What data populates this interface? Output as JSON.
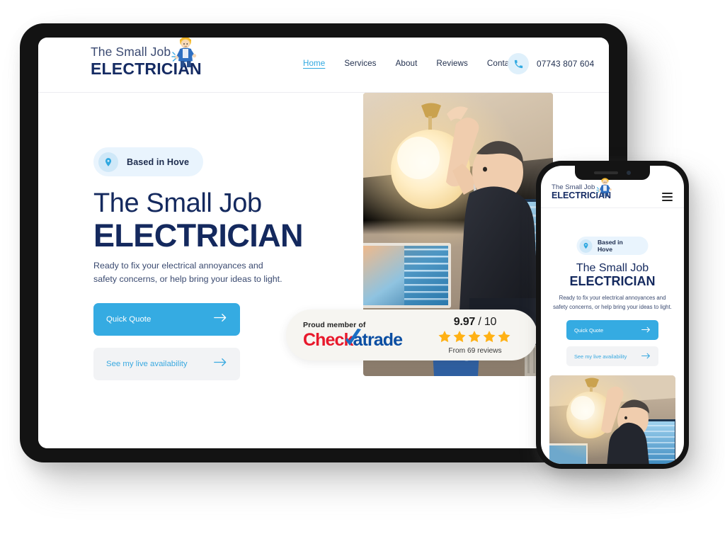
{
  "brand": {
    "logo_line1": "The Small Job",
    "logo_line2": "ELECTRICIAN",
    "mascot_icon": "electrician-mascot-icon",
    "accent_blue": "#35abe2",
    "navy": "#14295e",
    "badge_bg": "#e9f4fd"
  },
  "header": {
    "nav": [
      {
        "label": "Home",
        "active": true
      },
      {
        "label": "Services",
        "active": false
      },
      {
        "label": "About",
        "active": false
      },
      {
        "label": "Reviews",
        "active": false
      },
      {
        "label": "Contact",
        "active": false
      }
    ],
    "phone_icon": "phone-icon",
    "phone_number": "07743 807 604"
  },
  "hero": {
    "badge": {
      "icon": "location-pin-icon",
      "text": "Based in Hove"
    },
    "title_line1": "The Small Job",
    "title_line2": "ELECTRICIAN",
    "subtitle": "Ready to fix your electrical annoyances and safety concerns, or help bring your ideas to light.",
    "primary_button": {
      "label": "Quick Quote",
      "icon": "arrow-right-icon"
    },
    "secondary_button": {
      "label": "See my live availability",
      "icon": "arrow-right-icon"
    },
    "photo_alt": "electrician-installing-pendant-light"
  },
  "checkatrade": {
    "proud_member": "Proud member of",
    "logo_part_red": "Che",
    "logo_part_red2": "ck",
    "logo_part_blue": "atrade",
    "tick_icon": "blue-check-tick-icon",
    "score": "9.97",
    "score_separator": "/",
    "score_max": "10",
    "stars": "★★★★★",
    "star_count": 5,
    "star_color": "#ffb114",
    "reviews_text": "From 69 reviews"
  },
  "mobile": {
    "menu_icon": "hamburger-menu-icon",
    "badge": {
      "icon": "location-pin-icon",
      "text": "Based in Hove"
    },
    "title_line1": "The Small Job",
    "title_line2": "ELECTRICIAN",
    "subtitle": "Ready to fix your electrical annoyances and safety concerns, or help bring your ideas to light.",
    "primary_button": {
      "label": "Quick Quote",
      "icon": "arrow-right-icon"
    },
    "secondary_button": {
      "label": "See my live availability",
      "icon": "arrow-right-icon"
    },
    "photo_alt": "electrician-installing-pendant-light"
  }
}
